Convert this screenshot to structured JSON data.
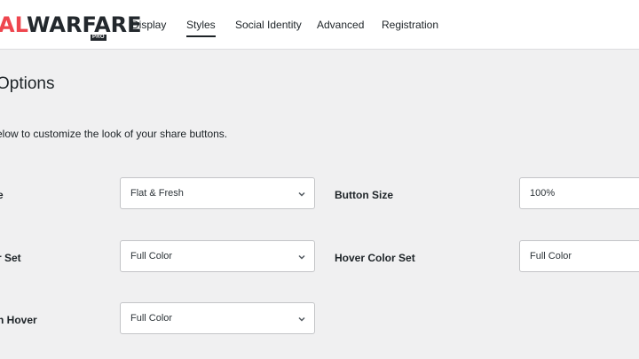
{
  "brand": {
    "part1": "AL",
    "part2": "WARFARE",
    "badge": "PRO"
  },
  "tabs": [
    {
      "label": "Display"
    },
    {
      "label": "Styles"
    },
    {
      "label": "Social Identity"
    },
    {
      "label": "Advanced"
    },
    {
      "label": "Registration"
    }
  ],
  "active_tab": "Styles",
  "section": {
    "title": "Options",
    "description": "elow to customize the look of your share buttons."
  },
  "fields": {
    "button_shape": {
      "label": "e",
      "value": "Flat & Fresh"
    },
    "button_size": {
      "label": "Button Size",
      "value": "100%"
    },
    "color_set": {
      "label": "r Set",
      "value": "Full Color"
    },
    "hover_color_set": {
      "label": "Hover Color Set",
      "value": "Full Color"
    },
    "single_hover": {
      "label": "n Hover",
      "value": "Full Color"
    }
  },
  "colors": {
    "brand_red": "#ee464f",
    "brand_dark": "#23282d",
    "background": "#f0f0f1"
  },
  "icons": {
    "select_arrow": "chevron-down-icon"
  }
}
